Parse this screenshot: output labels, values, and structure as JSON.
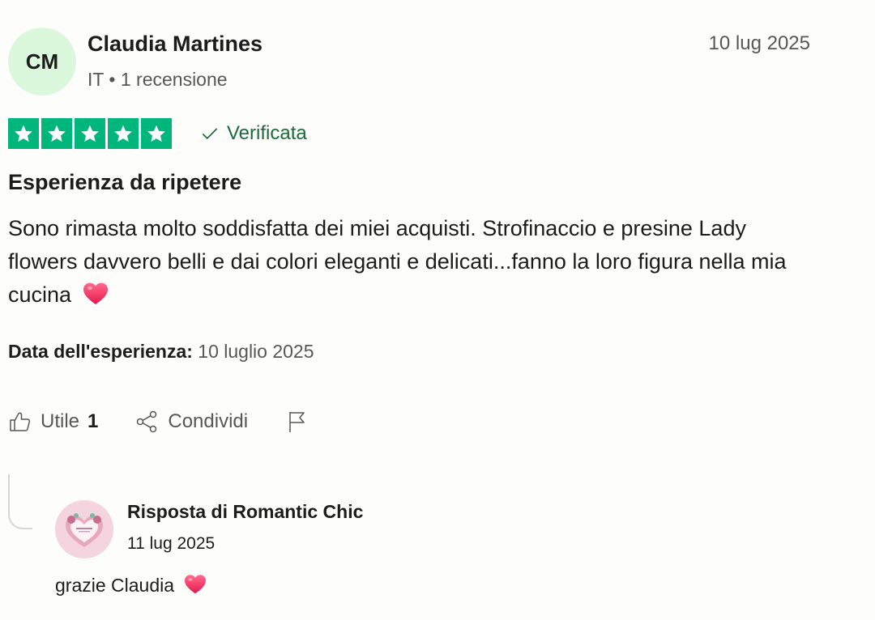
{
  "reviewer": {
    "initials": "CM",
    "name": "Claudia Martines",
    "meta": "IT • 1 recensione",
    "avatar_color": "#dcf8dc"
  },
  "review": {
    "date": "10 lug 2025",
    "rating": 5,
    "rating_max": 5,
    "star_color": "#00b67a",
    "verified_label": "Verificata",
    "title": "Esperienza da ripetere",
    "body": "Sono rimasta molto soddisfatta dei miei acquisti. Strofinaccio e presine Lady flowers davvero belli e dai colori eleganti e delicati...fanno la loro figura nella mia cucina",
    "body_emoji": "heart-icon",
    "experience_label": "Data dell'esperienza:",
    "experience_date": "10 luglio 2025"
  },
  "actions": {
    "useful_label": "Utile",
    "useful_count": "1",
    "share_label": "Condividi",
    "report_icon": "flag-icon"
  },
  "reply": {
    "author": "Risposta di Romantic Chic",
    "date": "11 lug 2025",
    "body": "grazie Claudia",
    "body_emoji": "heart-icon"
  }
}
